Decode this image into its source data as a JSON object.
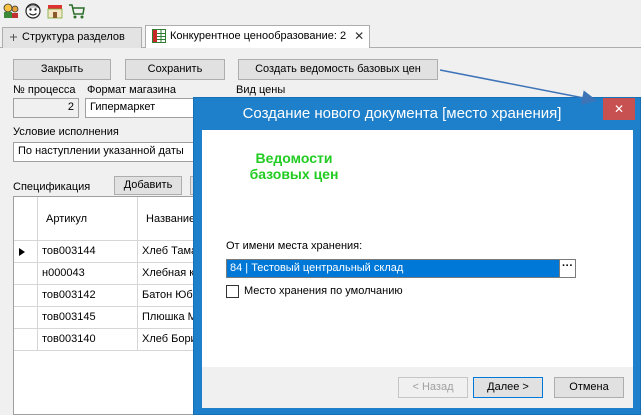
{
  "tabs": [
    {
      "label": "Структура разделов"
    },
    {
      "label": "Конкурентное ценообразование: 2"
    }
  ],
  "form": {
    "close_label": "Закрыть",
    "save_label": "Сохранить",
    "create_label": "Создать ведомость базовых цен",
    "process_no_label": "№ процесса",
    "process_no_value": "2",
    "store_format_label": "Формат магазина",
    "store_format_value": "Гипермаркет",
    "price_type_label": "Вид цены",
    "condition_label": "Условие исполнения",
    "condition_value": "По наступлении указанной даты",
    "spec_label": "Спецификация",
    "add_label": "Добавить"
  },
  "grid": {
    "columns": [
      "Артикул",
      "Название"
    ],
    "rows": [
      [
        "тов003144",
        "Хлеб Тама"
      ],
      [
        "н000043",
        "Хлебная к"
      ],
      [
        "тов003142",
        "Батон Юби"
      ],
      [
        "тов003145",
        "Плюшка  М"
      ],
      [
        "тов003140",
        "Хлеб Бори"
      ]
    ]
  },
  "dialog": {
    "title": "Создание нового документа [место хранения]",
    "note": "Ведомости\nбазовых цен",
    "field_label": "От имени места хранения:",
    "field_value": "84 | Тестовый центральный склад",
    "default_checkbox_label": "Место хранения по умолчанию",
    "back_label": "< Назад",
    "next_label": "Далее >",
    "cancel_label": "Отмена"
  },
  "colors": {
    "dialog_frame": "#1e7fca",
    "close_button": "#c75050",
    "note_green": "#22cc22",
    "arrow": "#3d74b8"
  }
}
